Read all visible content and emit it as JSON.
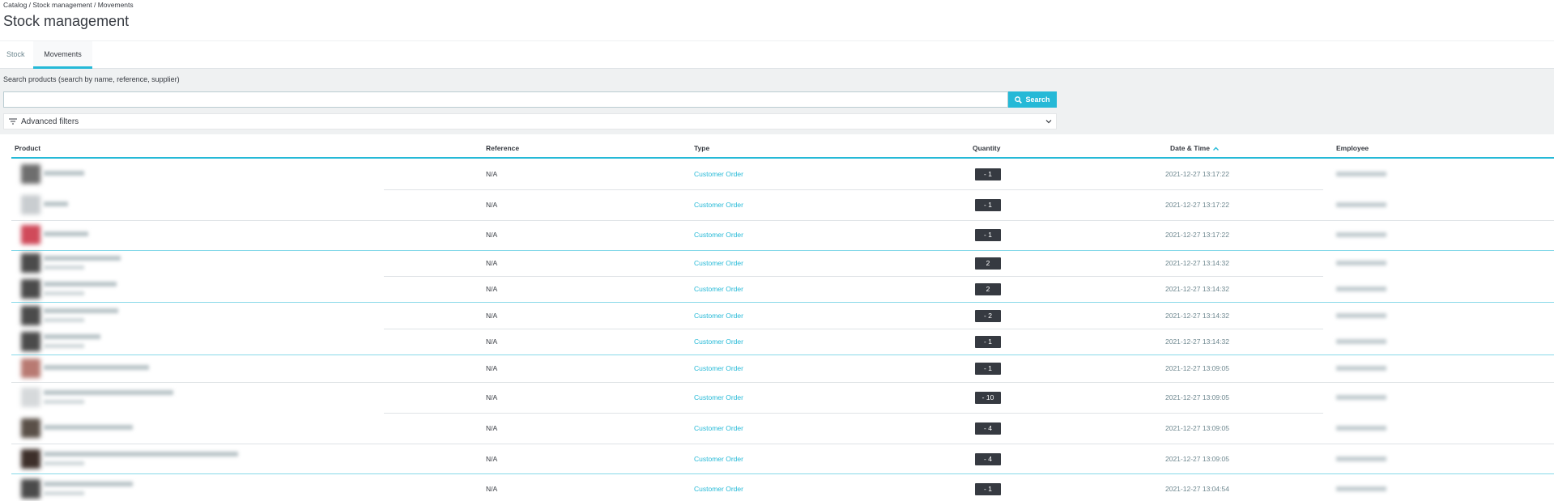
{
  "breadcrumb": "Catalog / Stock management / Movements",
  "page_title": "Stock management",
  "tabs": [
    {
      "label": "Stock",
      "active": false
    },
    {
      "label": "Movements",
      "active": true
    }
  ],
  "search": {
    "label": "Search products (search by name, reference, supplier)",
    "value": "",
    "placeholder": "",
    "button_label": "Search"
  },
  "advanced_filters": {
    "label": "Advanced filters"
  },
  "table": {
    "columns": [
      "Product",
      "Reference",
      "Type",
      "Quantity",
      "Date & Time",
      "Employee"
    ],
    "sort_column": "Date & Time",
    "sort_direction": "ascending",
    "rows": [
      {
        "reference": "N/A",
        "type": "Customer Order",
        "quantity": "- 1",
        "date": "2021-12-27 13:17:22"
      },
      {
        "reference": "N/A",
        "type": "Customer Order",
        "quantity": "- 1",
        "date": "2021-12-27 13:17:22"
      },
      {
        "reference": "N/A",
        "type": "Customer Order",
        "quantity": "- 1",
        "date": "2021-12-27 13:17:22"
      },
      {
        "reference": "N/A",
        "type": "Customer Order",
        "quantity": "2",
        "date": "2021-12-27 13:14:32"
      },
      {
        "reference": "N/A",
        "type": "Customer Order",
        "quantity": "2",
        "date": "2021-12-27 13:14:32"
      },
      {
        "reference": "N/A",
        "type": "Customer Order",
        "quantity": "- 2",
        "date": "2021-12-27 13:14:32"
      },
      {
        "reference": "N/A",
        "type": "Customer Order",
        "quantity": "- 1",
        "date": "2021-12-27 13:14:32"
      },
      {
        "reference": "N/A",
        "type": "Customer Order",
        "quantity": "- 1",
        "date": "2021-12-27 13:09:05"
      },
      {
        "reference": "N/A",
        "type": "Customer Order",
        "quantity": "- 10",
        "date": "2021-12-27 13:09:05"
      },
      {
        "reference": "N/A",
        "type": "Customer Order",
        "quantity": "- 4",
        "date": "2021-12-27 13:09:05"
      },
      {
        "reference": "N/A",
        "type": "Customer Order",
        "quantity": "- 4",
        "date": "2021-12-27 13:09:05"
      },
      {
        "reference": "N/A",
        "type": "Customer Order",
        "quantity": "- 1",
        "date": "2021-12-27 13:04:54"
      }
    ]
  },
  "colors": {
    "accent": "#25b9d7",
    "text": "#363a41",
    "badge": "#363a41",
    "panel": "#eff1f2"
  }
}
